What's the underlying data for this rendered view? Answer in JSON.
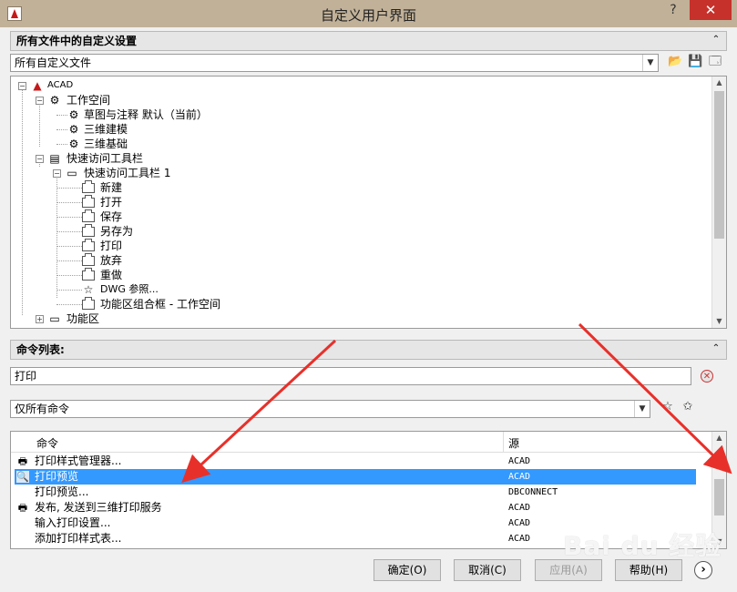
{
  "window": {
    "title": "自定义用户界面",
    "help_glyph": "?",
    "close_glyph": "✕"
  },
  "customizations_panel": {
    "header": "所有文件中的自定义设置",
    "collapse_glyph": "⌃",
    "file_select": "所有自定义文件",
    "tree": {
      "root": "ACAD",
      "workspaces": "工作空间",
      "ws_drafting": "草图与注释 默认（当前）",
      "ws_3d_modeling": "三维建模",
      "ws_3d_basics": "三维基础",
      "qat_group": "快速访问工具栏",
      "qat_1": "快速访问工具栏 1",
      "items": [
        "新建",
        "打开",
        "保存",
        "另存为",
        "打印",
        "放弃",
        "重做",
        "DWG 参照...",
        "功能区组合框 - 工作空间"
      ],
      "ribbon": "功能区"
    }
  },
  "command_list_panel": {
    "header": "命令列表:",
    "search_value": "打印",
    "filter_select": "仅所有命令",
    "columns": {
      "command": "命令",
      "source": "源"
    },
    "rows": [
      {
        "command": "打印样式管理器...",
        "source": "ACAD"
      },
      {
        "command": "打印预览",
        "source": "ACAD"
      },
      {
        "command": "打印预览...",
        "source": "DBCONNECT"
      },
      {
        "command": "发布, 发送到三维打印服务",
        "source": "ACAD"
      },
      {
        "command": "输入打印设置...",
        "source": "ACAD"
      },
      {
        "command": "添加打印样式表...",
        "source": "ACAD"
      }
    ]
  },
  "buttons": {
    "ok": "确定(O)",
    "cancel": "取消(C)",
    "apply": "应用(A)",
    "help": "帮助(H)"
  },
  "watermark": "Bai du 经验",
  "colors": {
    "selection": "#3399ff",
    "titlebar": "#c1b198",
    "annotation_arrow": "#e8302a"
  }
}
